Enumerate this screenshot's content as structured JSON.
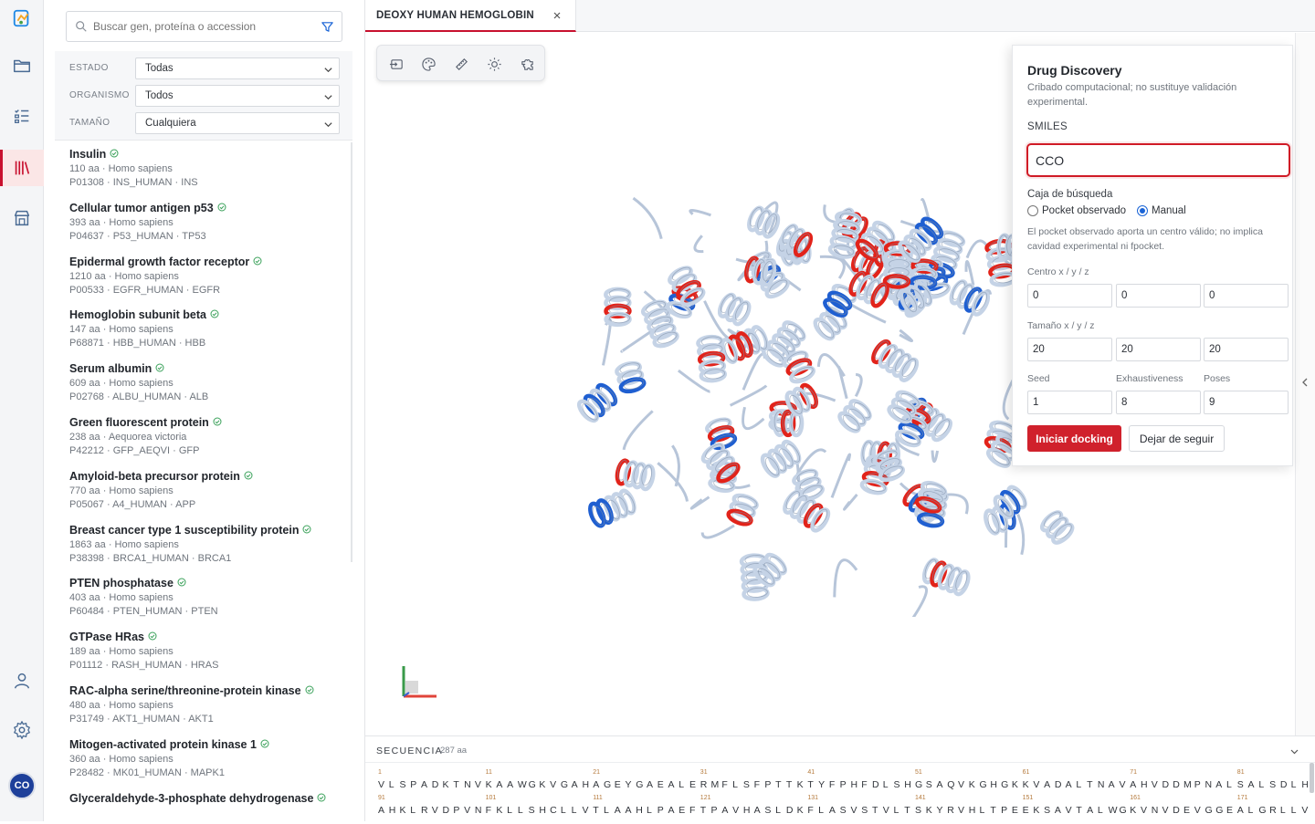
{
  "rail": {
    "avatar_initials": "CO"
  },
  "library": {
    "search_placeholder": "Buscar gen, proteína o accession",
    "filters": [
      {
        "label": "ESTADO",
        "value": "Todas"
      },
      {
        "label": "ORGANISMO",
        "value": "Todos"
      },
      {
        "label": "TAMAÑO",
        "value": "Cualquiera"
      }
    ],
    "proteins": [
      {
        "name": "Insulin",
        "meta": "110 aa · Homo sapiens",
        "ids": "P01308 · INS_HUMAN · INS"
      },
      {
        "name": "Cellular tumor antigen p53",
        "meta": "393 aa · Homo sapiens",
        "ids": "P04637 · P53_HUMAN · TP53"
      },
      {
        "name": "Epidermal growth factor receptor",
        "meta": "1210 aa · Homo sapiens",
        "ids": "P00533 · EGFR_HUMAN · EGFR"
      },
      {
        "name": "Hemoglobin subunit beta",
        "meta": "147 aa · Homo sapiens",
        "ids": "P68871 · HBB_HUMAN · HBB"
      },
      {
        "name": "Serum albumin",
        "meta": "609 aa · Homo sapiens",
        "ids": "P02768 · ALBU_HUMAN · ALB"
      },
      {
        "name": "Green fluorescent protein",
        "meta": "238 aa · Aequorea victoria",
        "ids": "P42212 · GFP_AEQVI · GFP"
      },
      {
        "name": "Amyloid-beta precursor protein",
        "meta": "770 aa · Homo sapiens",
        "ids": "P05067 · A4_HUMAN · APP"
      },
      {
        "name": "Breast cancer type 1 susceptibility protein",
        "meta": "1863 aa · Homo sapiens",
        "ids": "P38398 · BRCA1_HUMAN · BRCA1"
      },
      {
        "name": "PTEN phosphatase",
        "meta": "403 aa · Homo sapiens",
        "ids": "P60484 · PTEN_HUMAN · PTEN"
      },
      {
        "name": "GTPase HRas",
        "meta": "189 aa · Homo sapiens",
        "ids": "P01112 · RASH_HUMAN · HRAS"
      },
      {
        "name": "RAC-alpha serine/threonine-protein kinase",
        "meta": "480 aa · Homo sapiens",
        "ids": "P31749 · AKT1_HUMAN · AKT1"
      },
      {
        "name": "Mitogen-activated protein kinase 1",
        "meta": "360 aa · Homo sapiens",
        "ids": "P28482 · MK01_HUMAN · MAPK1"
      },
      {
        "name": "Glyceraldehyde-3-phosphate dehydrogenase",
        "meta": "",
        "ids": ""
      }
    ]
  },
  "tab": {
    "label": "DEOXY HUMAN HEMOGLOBIN"
  },
  "toolbar": {
    "icons": [
      "import-icon",
      "palette-icon",
      "ruler-icon",
      "lighting-icon",
      "puzzle-icon"
    ]
  },
  "docking": {
    "title": "Drug Discovery",
    "subtitle": "Cribado computacional; no sustituye validación experimental.",
    "smiles_label": "SMILES",
    "smiles_value": "CCO",
    "box_label": "Caja de búsqueda",
    "radio_pocket": "Pocket observado",
    "radio_manual": "Manual",
    "selected_box": "Manual",
    "note": "El pocket observado aporta un centro válido; no implica cavidad experimental ni fpocket.",
    "center_label": "Centro x / y / z",
    "center": [
      "0",
      "0",
      "0"
    ],
    "size_label": "Tamaño x / y / z",
    "size": [
      "20",
      "20",
      "20"
    ],
    "seed_label": "Seed",
    "seed": "1",
    "exhaustiveness_label": "Exhaustiveness",
    "exhaustiveness": "8",
    "poses_label": "Poses",
    "poses": "9",
    "run_button": "Iniciar docking",
    "unfollow_button": "Dejar de seguir"
  },
  "sequence": {
    "header": "SECUENCIA",
    "length": "287 aa",
    "line1": "VLSPADKTNVKAAWGKVGAHAGEYGAEALERMFLSFPTTKTYFPHFDLSHGSAQVKGHGKKVADALTNAVAHVDDMPNALSALSDLH",
    "line1_positions": [
      "1",
      "11",
      "21",
      "31",
      "41",
      "51",
      "61",
      "71",
      "81"
    ],
    "line2": "AHKLRVDPVNFKLLSHCLLVTLAAHLPAEFTPAVHASLDKFLASVSTVLTSKYRVHLTPEEKSAVTALWGKVNVDEVGGEALGRLLV",
    "line2_positions": [
      "91",
      "101",
      "111",
      "121",
      "131",
      "141",
      "151",
      "161",
      "171"
    ]
  },
  "colors": {
    "accent": "#c8102e",
    "helix": "#c5d3e6",
    "helix_red": "#e2231a",
    "helix_blue": "#1f5fd1"
  }
}
